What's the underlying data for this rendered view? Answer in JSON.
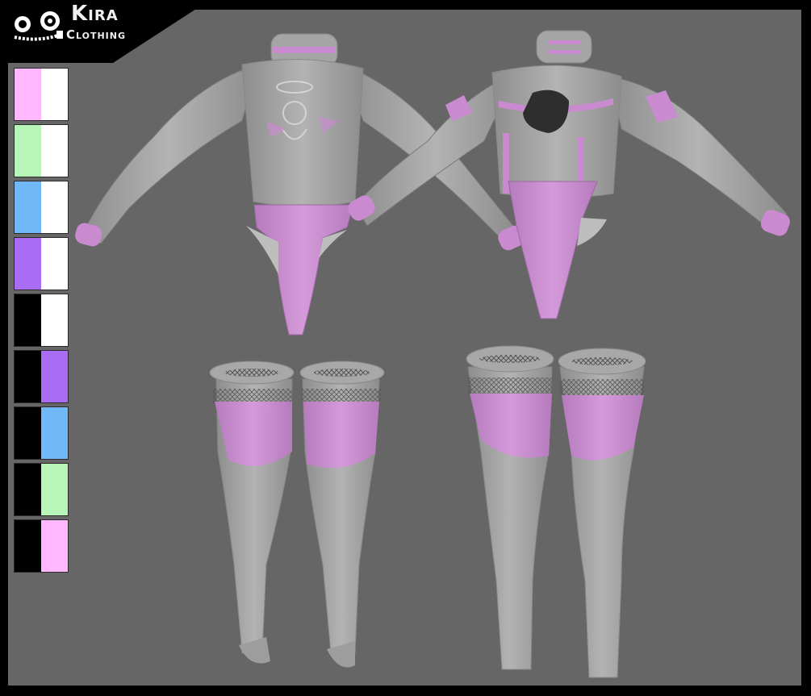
{
  "brand": {
    "title": "Kira",
    "subtitle": "Clothing"
  },
  "colors": {
    "background": "#666666",
    "frame": "#000000",
    "fabric_base": "#a9a9a9",
    "fabric_accent": "#c98ad0"
  },
  "swatches": [
    {
      "left": "#ffb8ff",
      "right": "#ffffff"
    },
    {
      "left": "#b8f5b8",
      "right": "#ffffff"
    },
    {
      "left": "#70b8f8",
      "right": "#ffffff"
    },
    {
      "left": "#a86cf5",
      "right": "#ffffff"
    },
    {
      "left": "#000000",
      "right": "#ffffff"
    },
    {
      "left": "#000000",
      "right": "#a86cf5"
    },
    {
      "left": "#000000",
      "right": "#70b8f8"
    },
    {
      "left": "#000000",
      "right": "#b8f5b8"
    },
    {
      "left": "#000000",
      "right": "#ffb8ff"
    }
  ]
}
